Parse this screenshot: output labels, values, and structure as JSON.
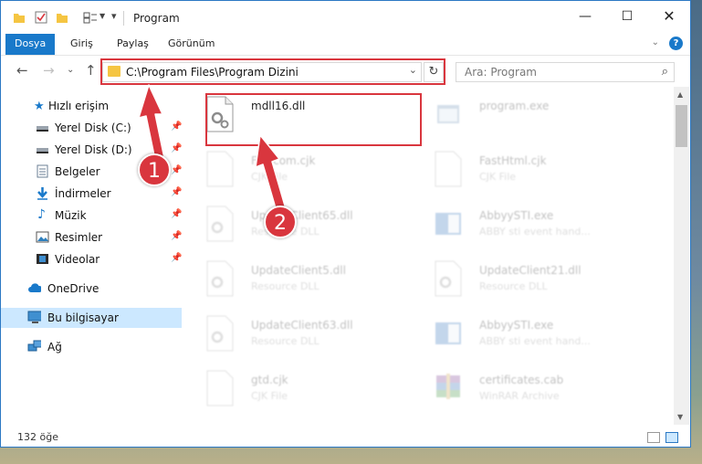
{
  "window": {
    "title": "Program"
  },
  "ribbon": {
    "tabs": [
      "Dosya",
      "Giriş",
      "Paylaş",
      "Görünüm"
    ]
  },
  "address": {
    "path": "C:\\Program Files\\Program Dizini"
  },
  "search": {
    "placeholder": "Ara: Program"
  },
  "nav": {
    "quick_access": "Hızlı erişim",
    "items": [
      {
        "label": "Yerel Disk (C:)",
        "icon": "drive-icon"
      },
      {
        "label": "Yerel Disk (D:)",
        "icon": "drive-icon"
      },
      {
        "label": "Belgeler",
        "icon": "documents-icon"
      },
      {
        "label": "İndirmeler",
        "icon": "download-icon"
      },
      {
        "label": "Müzik",
        "icon": "music-icon"
      },
      {
        "label": "Resimler",
        "icon": "pictures-icon"
      },
      {
        "label": "Videolar",
        "icon": "videos-icon"
      }
    ],
    "onedrive": "OneDrive",
    "this_pc": "Bu bilgisayar",
    "network": "Ağ"
  },
  "files": [
    {
      "name": "mdll16.dll",
      "type": ""
    },
    {
      "name": "program.exe",
      "type": ""
    },
    {
      "name": "Fastcom.cjk",
      "type": "CJK File"
    },
    {
      "name": "FastHtml.cjk",
      "type": "CJK File"
    },
    {
      "name": "UpdateClient65.dll",
      "type": "Resource DLL"
    },
    {
      "name": "AbbyySTI.exe",
      "type": "ABBY sti event hand..."
    },
    {
      "name": "UpdateClient5.dll",
      "type": "Resource DLL"
    },
    {
      "name": "UpdateClient21.dll",
      "type": "Resource DLL"
    },
    {
      "name": "UpdateClient63.dll",
      "type": "Resource DLL"
    },
    {
      "name": "AbbyySTI.exe",
      "type": "ABBY sti event hand..."
    },
    {
      "name": "gtd.cjk",
      "type": "CJK File"
    },
    {
      "name": "certificates.cab",
      "type": "WinRAR Archive"
    }
  ],
  "status": {
    "count": "132 öğe"
  },
  "annotations": {
    "step1": "1",
    "step2": "2"
  },
  "colors": {
    "accent": "#1979ca",
    "highlight": "#d9363e",
    "folder": "#f5c542"
  }
}
